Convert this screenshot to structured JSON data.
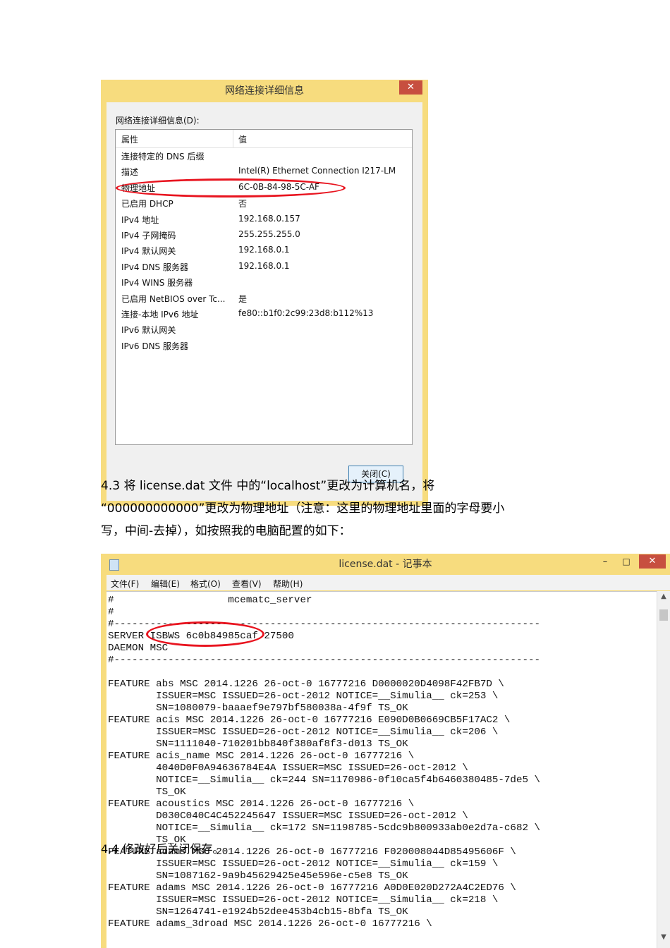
{
  "dialog": {
    "title": "网络连接详细信息",
    "close_icon": "✕",
    "label": "网络连接详细信息(D):",
    "col_property": "属性",
    "col_value": "值",
    "rows": [
      {
        "prop": "连接特定的 DNS 后缀",
        "value": ""
      },
      {
        "prop": "描述",
        "value": "Intel(R) Ethernet Connection I217-LM"
      },
      {
        "prop": "物理地址",
        "value": "6C-0B-84-98-5C-AF"
      },
      {
        "prop": "已启用 DHCP",
        "value": "否"
      },
      {
        "prop": "IPv4 地址",
        "value": "192.168.0.157"
      },
      {
        "prop": "IPv4 子网掩码",
        "value": "255.255.255.0"
      },
      {
        "prop": "IPv4 默认网关",
        "value": "192.168.0.1"
      },
      {
        "prop": "IPv4 DNS 服务器",
        "value": "192.168.0.1"
      },
      {
        "prop": "IPv4 WINS 服务器",
        "value": ""
      },
      {
        "prop": "已启用 NetBIOS over Tc...",
        "value": "是"
      },
      {
        "prop": "连接-本地 IPv6 地址",
        "value": "fe80::b1f0:2c99:23d8:b112%13"
      },
      {
        "prop": "IPv6 默认网关",
        "value": ""
      },
      {
        "prop": "IPv6 DNS 服务器",
        "value": ""
      }
    ],
    "close_button": "关闭(C)"
  },
  "doc": {
    "para1_line1": "4.3 将 license.dat 文件 中的“localhost”更改为计算机名，将",
    "para1_line2": "“000000000000”更改为物理地址（注意：这里的物理地址里面的字母要小",
    "para1_line3": "写，中间-去掉），如按照我的电脑配置的如下：",
    "para2": "4.4 修改好后关闭保存。"
  },
  "notepad": {
    "title": "license.dat - 记事本",
    "icon": "notepad-icon",
    "min_icon": "–",
    "max_icon": "□",
    "close_icon": "✕",
    "menu": [
      "文件(F)",
      "编辑(E)",
      "格式(O)",
      "查看(V)",
      "帮助(H)"
    ],
    "scroll_up": "▲",
    "scroll_down": "▼",
    "lines": [
      "#                   mcematc_server",
      "#",
      "#-----------------------------------------------------------------------",
      "SERVER ISBWS 6c0b84985caf 27500",
      "DAEMON MSC",
      "#-----------------------------------------------------------------------",
      "",
      "FEATURE abs MSC 2014.1226 26-oct-0 16777216 D0000020D4098F42FB7D \\",
      "        ISSUER=MSC ISSUED=26-oct-2012 NOTICE=__Simulia__ ck=253 \\",
      "        SN=1080079-baaaef9e797bf580038a-4f9f TS_OK",
      "FEATURE acis MSC 2014.1226 26-oct-0 16777216 E090D0B0669CB5F17AC2 \\",
      "        ISSUER=MSC ISSUED=26-oct-2012 NOTICE=__Simulia__ ck=206 \\",
      "        SN=1111040-710201bb840f380af8f3-d013 TS_OK",
      "FEATURE acis_name MSC 2014.1226 26-oct-0 16777216 \\",
      "        4040D0F0A94636784E4A ISSUER=MSC ISSUED=26-oct-2012 \\",
      "        NOTICE=__Simulia__ ck=244 SN=1170986-0f10ca5f4b6460380485-7de5 \\",
      "        TS_OK",
      "FEATURE acoustics MSC 2014.1226 26-oct-0 16777216 \\",
      "        D030C040C4C452245647 ISSUER=MSC ISSUED=26-oct-2012 \\",
      "        NOTICE=__Simulia__ ck=172 SN=1198785-5cdc9b800933ab0e2d7a-c682 \\",
      "        TS_OK",
      "FEATURE adams MSC 2014.1226 26-oct-0 16777216 F020008044D85495606F \\",
      "        ISSUER=MSC ISSUED=26-oct-2012 NOTICE=__Simulia__ ck=159 \\",
      "        SN=1087162-9a9b45629425e45e596e-c5e8 TS_OK",
      "FEATURE adams MSC 2014.1226 26-oct-0 16777216 A0D0E020D272A4C2ED76 \\",
      "        ISSUER=MSC ISSUED=26-oct-2012 NOTICE=__Simulia__ ck=218 \\",
      "        SN=1264741-e1924b52dee453b4cb15-8bfa TS_OK",
      "FEATURE adams_3droad MSC 2014.1226 26-oct-0 16777216 \\"
    ]
  }
}
